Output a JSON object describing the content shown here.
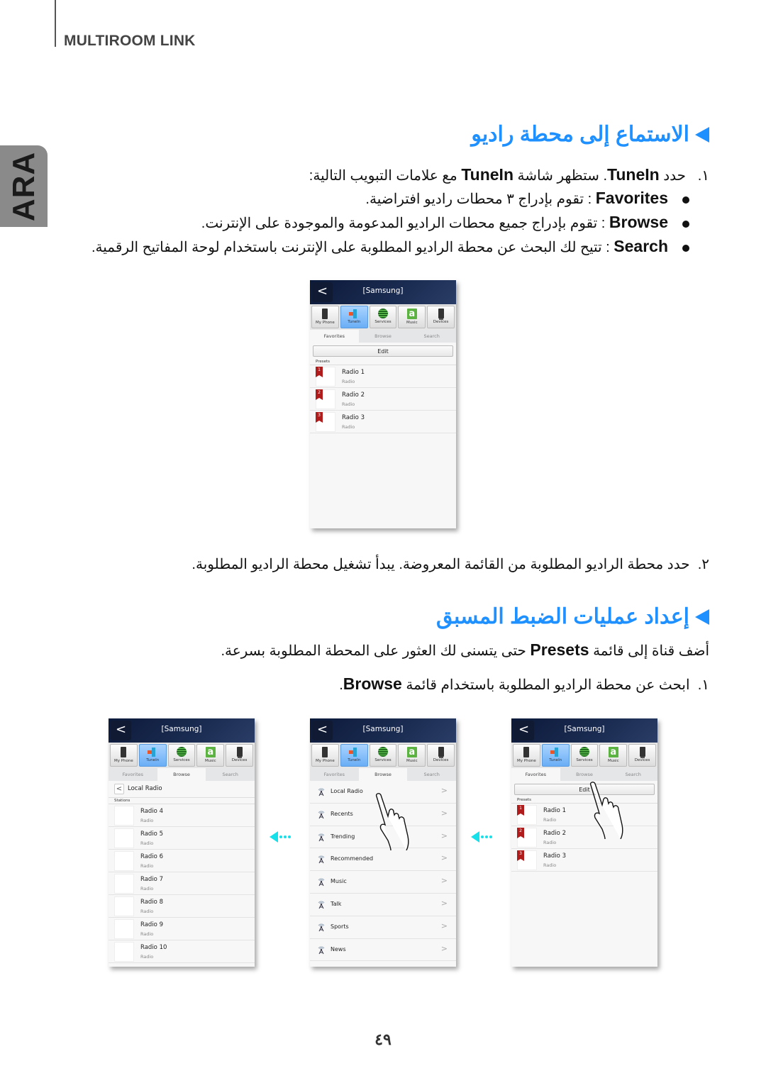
{
  "header": {
    "section_label": "MULTIROOM LINK",
    "language_tab": "ARA"
  },
  "section1": {
    "heading": "الاستماع إلى محطة راديو",
    "step1": {
      "num": "١.",
      "pre": "حدد ",
      "b1": "TuneIn",
      "mid": ". ستظهر شاشة ",
      "b2": "TuneIn",
      "post": " مع علامات التبويب التالية:"
    },
    "bullets": [
      {
        "term": "Favorites",
        "text": " : تقوم بإدراج ٣ محطات راديو افتراضية."
      },
      {
        "term": "Browse",
        "text": " : تقوم بإدراج جميع محطات الراديو المدعومة والموجودة على الإنترنت."
      },
      {
        "term": "Search",
        "text": " : تتيح لك البحث عن محطة الراديو المطلوبة على الإنترنت باستخدام لوحة المفاتيح الرقمية."
      }
    ],
    "step2": {
      "num": "٢.",
      "text": "حدد محطة الراديو المطلوبة من القائمة المعروضة. يبدأ تشغيل محطة الراديو المطلوبة."
    }
  },
  "section2": {
    "heading": "إعداد عمليات الضبط المسبق",
    "intro": {
      "pre": "أضف قناة إلى قائمة ",
      "term": "Presets",
      "post": " حتى يتسنى لك العثور على المحطة المطلوبة بسرعة."
    },
    "step1": {
      "num": "١.",
      "pre": "ابحث عن محطة الراديو المطلوبة باستخدام قائمة ",
      "term": "Browse",
      "post": "."
    }
  },
  "app": {
    "title": "[Samsung]",
    "back_glyph": "<",
    "sources": [
      "My Phone",
      "TuneIn",
      "Services",
      "Music",
      "Devices"
    ],
    "tabs": [
      "Favorites",
      "Browse",
      "Search"
    ],
    "edit_label": "Edit",
    "presets_label": "Presets",
    "stations_label": "Stations",
    "radio_sub": "Radio",
    "presets": [
      {
        "badge": "1",
        "name": "Radio 1"
      },
      {
        "badge": "2",
        "name": "Radio 2"
      },
      {
        "badge": "3",
        "name": "Radio 3"
      }
    ],
    "local_radio": "Local Radio",
    "stations": [
      "Radio 4",
      "Radio 5",
      "Radio 6",
      "Radio 7",
      "Radio 8",
      "Radio 9",
      "Radio 10"
    ],
    "categories": [
      "Local Radio",
      "Recents",
      "Trending",
      "Recommended",
      "Music",
      "Talk",
      "Sports",
      "News"
    ],
    "chevron": ">"
  },
  "colors": {
    "heading": "#1e90ff",
    "arrow": "#16e0ea",
    "preset_badge": "#b01c1c"
  },
  "footer": {
    "page_number": "٤٩"
  }
}
